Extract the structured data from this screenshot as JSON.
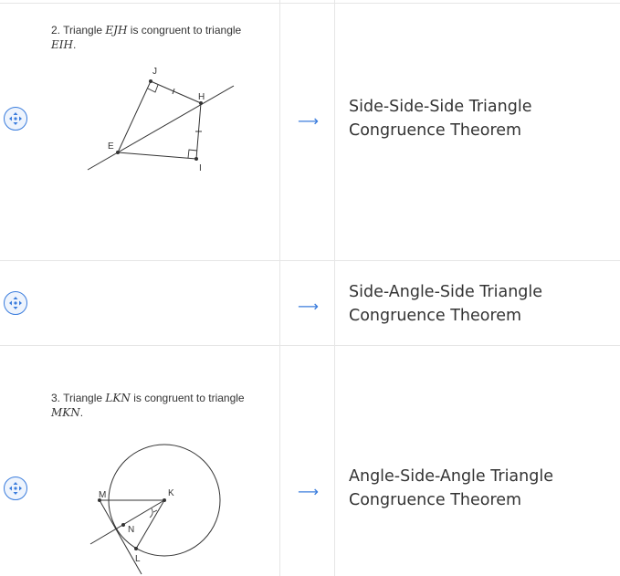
{
  "rows": [
    {
      "problem": {
        "number": "2.",
        "prefix": "Triangle",
        "triangle1": "EJH",
        "middle": "is congruent to triangle",
        "triangle2": "EIH",
        "end": "."
      },
      "figure_labels": {
        "J": "J",
        "H": "H",
        "E": "E",
        "I": "I"
      },
      "answer": "Side-Side-Side Triangle Congruence Theorem"
    },
    {
      "answer": "Side-Angle-Side Triangle Congruence Theorem"
    },
    {
      "problem": {
        "number": "3.",
        "prefix": "Triangle",
        "triangle1": "LKN",
        "middle": "is congruent to triangle",
        "triangle2": "MKN",
        "end": "."
      },
      "figure_labels": {
        "M": "M",
        "K": "K",
        "N": "N",
        "L": "L"
      },
      "answer": "Angle-Side-Angle Triangle Congruence Theorem"
    }
  ],
  "icons": {
    "drag_handle": "move-icon",
    "arrow": "right-arrow-icon",
    "arrow_glyph": "⟶"
  },
  "colors": {
    "accent": "#3b7ddd",
    "divider": "#e6e6e6",
    "text": "#333333"
  }
}
